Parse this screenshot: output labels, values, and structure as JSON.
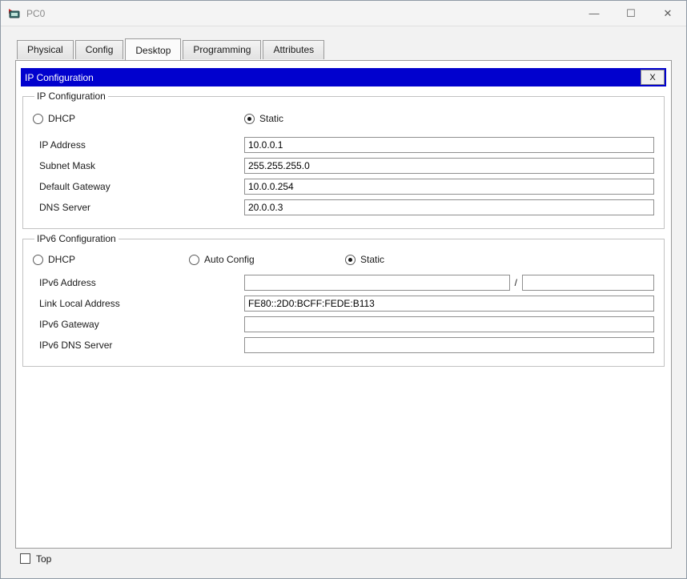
{
  "window": {
    "title": "PC0",
    "controls": {
      "minimize": "—",
      "maximize": "☐",
      "close": "✕"
    }
  },
  "tabs": [
    {
      "label": "Physical",
      "active": false
    },
    {
      "label": "Config",
      "active": false
    },
    {
      "label": "Desktop",
      "active": true
    },
    {
      "label": "Programming",
      "active": false
    },
    {
      "label": "Attributes",
      "active": false
    }
  ],
  "dialog": {
    "title": "IP Configuration",
    "close_label": "X",
    "accent_color": "#0101ce"
  },
  "ipv4": {
    "group_title": "IP Configuration",
    "radios": [
      {
        "label": "DHCP",
        "checked": false
      },
      {
        "label": "Static",
        "checked": true
      }
    ],
    "fields": [
      {
        "label": "IP Address",
        "value": "10.0.0.1"
      },
      {
        "label": "Subnet Mask",
        "value": "255.255.255.0"
      },
      {
        "label": "Default Gateway",
        "value": "10.0.0.254"
      },
      {
        "label": "DNS Server",
        "value": "20.0.0.3"
      }
    ]
  },
  "ipv6": {
    "group_title": "IPv6 Configuration",
    "radios": [
      {
        "label": "DHCP",
        "checked": false
      },
      {
        "label": "Auto Config",
        "checked": false
      },
      {
        "label": "Static",
        "checked": true
      }
    ],
    "prefix_separator": "/",
    "fields": [
      {
        "label": "IPv6 Address",
        "value": "",
        "prefix": ""
      },
      {
        "label": "Link Local Address",
        "value": "FE80::2D0:BCFF:FEDE:B113"
      },
      {
        "label": "IPv6 Gateway",
        "value": ""
      },
      {
        "label": "IPv6 DNS Server",
        "value": ""
      }
    ]
  },
  "footer": {
    "top_label": "Top",
    "top_checked": false
  }
}
